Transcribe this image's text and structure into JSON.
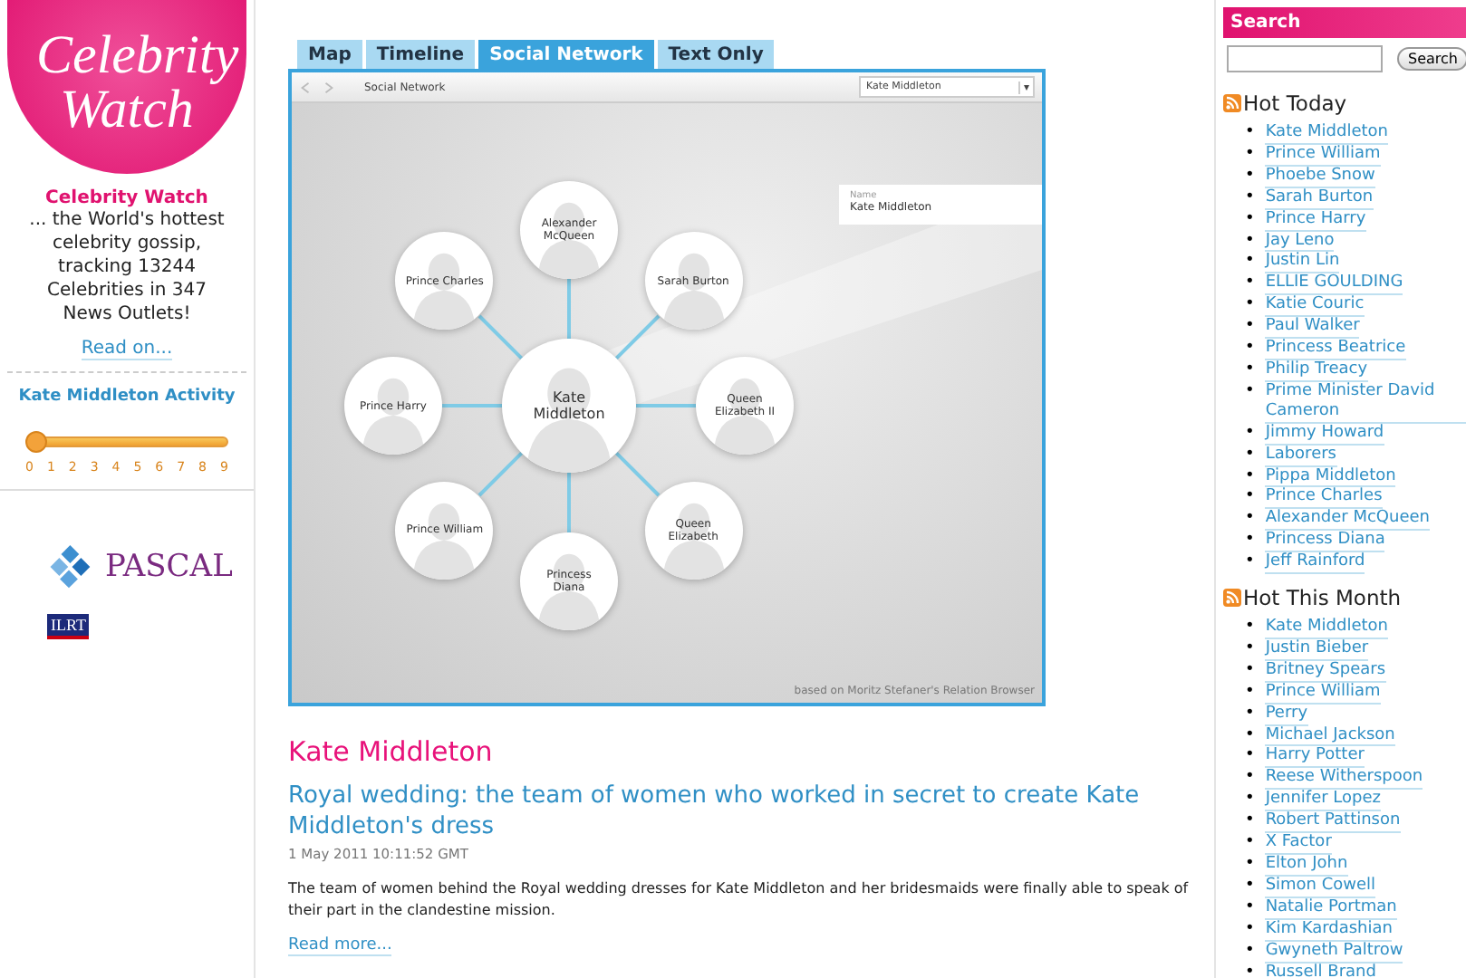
{
  "logo": {
    "text": "Celebrity Watch"
  },
  "intro": {
    "title": "Celebrity Watch",
    "text": "... the World's hottest celebrity gossip, tracking 13244 Celebrities in 347 News Outlets!",
    "link": "Read on..."
  },
  "activity": {
    "title": "Kate Middleton Activity",
    "level": 0,
    "ticks": [
      "0",
      "1",
      "2",
      "3",
      "4",
      "5",
      "6",
      "7",
      "8",
      "9"
    ]
  },
  "partners": [
    {
      "kind": "pascal",
      "label": "PASCAL"
    },
    {
      "kind": "ilrt",
      "label": "ILRT"
    }
  ],
  "tabs": [
    {
      "label": "Map",
      "selected": false
    },
    {
      "label": "Timeline",
      "selected": false
    },
    {
      "label": "Social Network",
      "selected": true
    },
    {
      "label": "Text Only",
      "selected": false
    }
  ],
  "browser": {
    "title": "Social Network",
    "dropdown": "Kate Middleton",
    "dropdown_arrow": "▾",
    "info_panel": {
      "label": "Name",
      "value": "Kate Middleton"
    },
    "credit": "based on Moritz Stefaner's Relation Browser",
    "nodes": [
      {
        "label": "Alexander McQueen",
        "kind": "related"
      },
      {
        "label": "Prince Charles",
        "kind": "related"
      },
      {
        "label": "Sarah Burton",
        "kind": "related"
      },
      {
        "label": "Prince Harry",
        "kind": "related"
      },
      {
        "label": "Kate Middleton",
        "kind": "center"
      },
      {
        "label": "Queen Elizabeth II",
        "kind": "related"
      },
      {
        "label": "Prince William",
        "kind": "related"
      },
      {
        "label": "Queen Elizabeth",
        "kind": "related"
      },
      {
        "label": "Princess Diana",
        "kind": "related"
      }
    ]
  },
  "article": {
    "heading": "Kate Middleton",
    "title": "Royal wedding: the team of women who worked in secret to create Kate Middleton's dress",
    "date": "1 May 2011 10:11:52 GMT",
    "summary": "The team of women behind the Royal wedding dresses for Kate Middleton and her bridesmaids were finally able to speak of their part in the clandestine mission.",
    "link": "Read more..."
  },
  "search": {
    "title": "Search",
    "button": "Search"
  },
  "hot_today": {
    "title": "Hot Today",
    "marker": "•",
    "items": [
      "Kate Middleton",
      "Prince William",
      "Phoebe Snow",
      "Sarah Burton",
      "Prince Harry",
      "Jay Leno",
      "Justin Lin",
      "ELLIE GOULDING",
      "Katie Couric",
      "Paul Walker",
      "Princess Beatrice",
      "Philip Treacy",
      "Prime Minister David Cameron",
      "Jimmy Howard",
      "Laborers",
      "Pippa Middleton",
      "Prince Charles",
      "Alexander McQueen",
      "Princess Diana",
      "Jeff Rainford"
    ]
  },
  "hot_this_month": {
    "title": "Hot This Month",
    "marker": "•",
    "items": [
      "Kate Middleton",
      "Justin Bieber",
      "Britney Spears",
      "Prince William",
      "Perry",
      "Michael Jackson",
      "Harry Potter",
      "Reese Witherspoon",
      "Jennifer Lopez",
      "Robert Pattinson",
      "X Factor",
      "Elton John",
      "Simon Cowell",
      "Natalie Portman",
      "Kim Kardashian",
      "Gwyneth Paltrow",
      "Russell Brand"
    ]
  }
}
